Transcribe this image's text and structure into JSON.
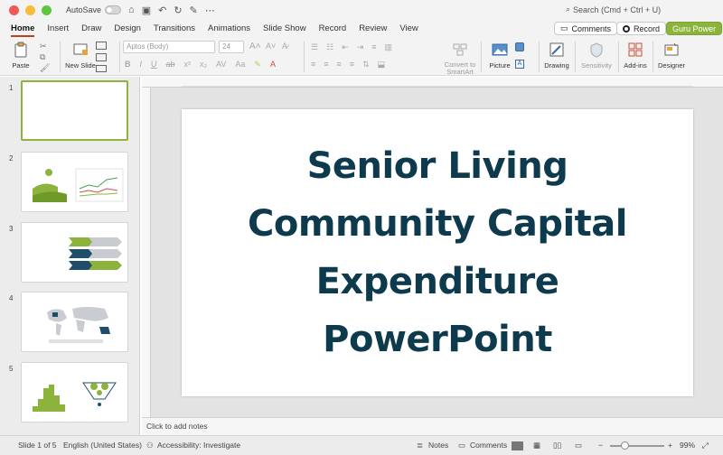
{
  "titlebar": {
    "autosave_label": "AutoSave",
    "search_placeholder": "Search (Cmd + Ctrl + U)"
  },
  "tabs": [
    {
      "label": "Home",
      "active": true
    },
    {
      "label": "Insert"
    },
    {
      "label": "Draw"
    },
    {
      "label": "Design"
    },
    {
      "label": "Transitions"
    },
    {
      "label": "Animations"
    },
    {
      "label": "Slide Show"
    },
    {
      "label": "Record"
    },
    {
      "label": "Review"
    },
    {
      "label": "View"
    }
  ],
  "ribbon_buttons": {
    "comments": "Comments",
    "record": "Record",
    "guru": "Guru Power"
  },
  "ribbon": {
    "paste": "Paste",
    "new_slide": "New Slide",
    "font_name": "Aptos (Body)",
    "font_size": "24",
    "convert_smartart": "Convert to SmartArt",
    "picture": "Picture",
    "drawing": "Drawing",
    "sensitivity": "Sensitivity",
    "addins": "Add-ins",
    "designer": "Designer"
  },
  "thumbnails": [
    {
      "number": "1"
    },
    {
      "number": "2"
    },
    {
      "number": "3"
    },
    {
      "number": "4"
    },
    {
      "number": "5"
    }
  ],
  "slide": {
    "title_lines": [
      "Senior Living",
      "Community Capital",
      "Expenditure",
      "PowerPoint"
    ]
  },
  "notes_placeholder": "Click to add notes",
  "status": {
    "slide_counter": "Slide 1 of 5",
    "language": "English (United States)",
    "accessibility": "Accessibility: Investigate",
    "notes": "Notes",
    "comments": "Comments",
    "zoom": "99%"
  },
  "colors": {
    "accent_green": "#8cb33b",
    "title_navy": "#0e3a4e",
    "active_tab_underline": "#c43e1c"
  }
}
